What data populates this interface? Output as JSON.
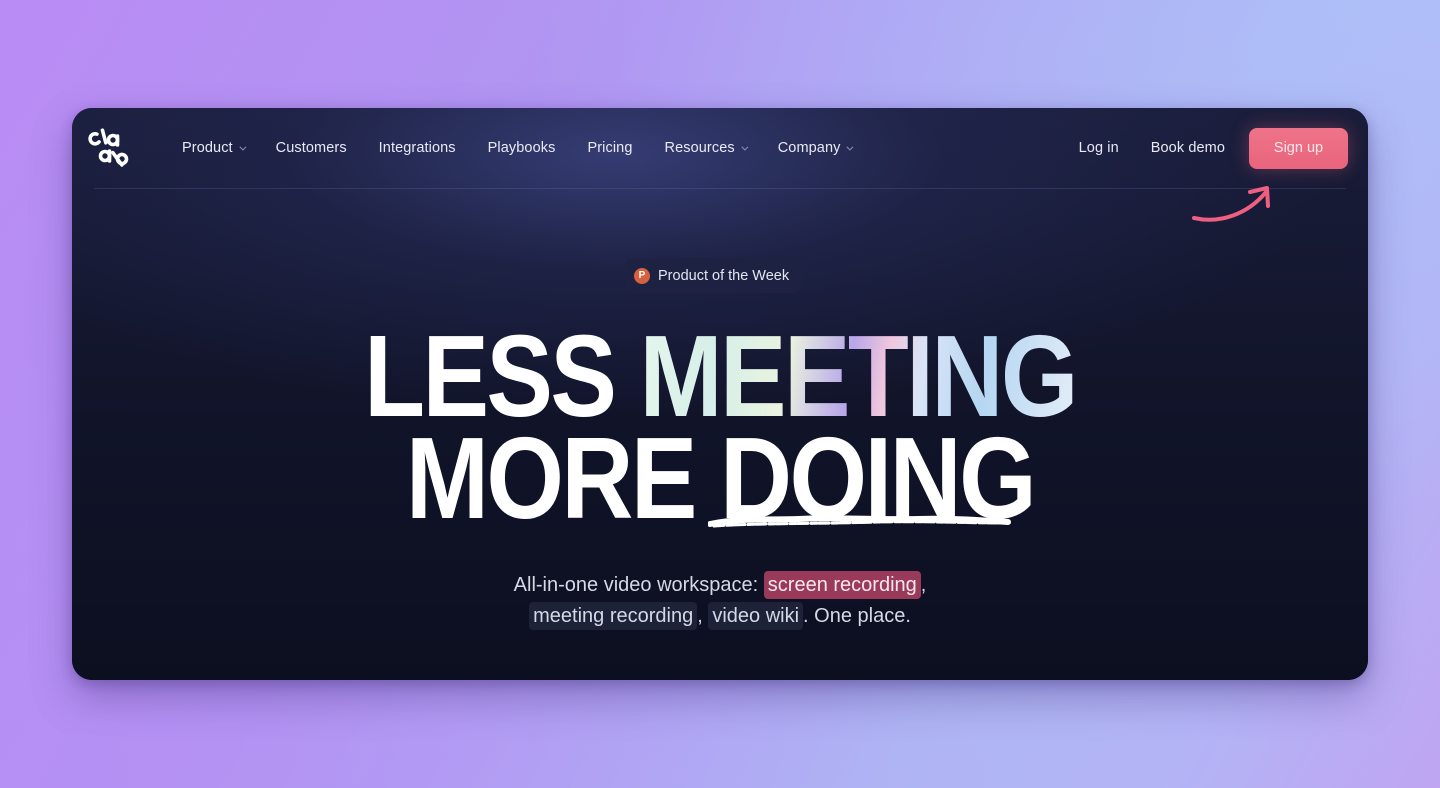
{
  "brand": {
    "logo_text": "claap",
    "accent_color": "#e9647c"
  },
  "nav": {
    "items": [
      {
        "label": "Product",
        "has_dropdown": true
      },
      {
        "label": "Customers",
        "has_dropdown": false
      },
      {
        "label": "Integrations",
        "has_dropdown": false
      },
      {
        "label": "Playbooks",
        "has_dropdown": false
      },
      {
        "label": "Pricing",
        "has_dropdown": false
      },
      {
        "label": "Resources",
        "has_dropdown": true
      },
      {
        "label": "Company",
        "has_dropdown": true
      }
    ],
    "login_label": "Log in",
    "book_demo_label": "Book demo",
    "signup_label": "Sign up"
  },
  "badge": {
    "icon": "product-hunt-icon",
    "icon_letter": "P",
    "label": "Product of the Week"
  },
  "hero": {
    "line1_plain": "LESS ",
    "line1_highlight": "MEETING",
    "line2_plain": "MORE ",
    "line2_highlight": "DOING"
  },
  "subtitle": {
    "prefix": "All-in-one video workspace: ",
    "highlight1": "screen recording",
    "sep1": ",",
    "highlight2": "meeting recording",
    "sep2": ", ",
    "highlight3": "video wiki",
    "suffix": ". One place."
  }
}
